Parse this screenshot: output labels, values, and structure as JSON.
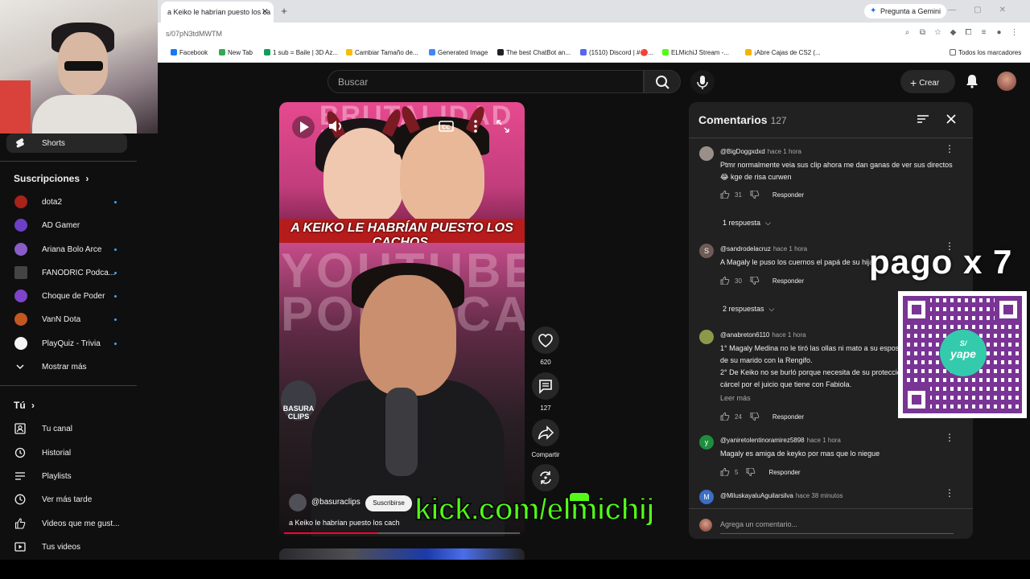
{
  "browser": {
    "tab_title": "a Keiko le habrían puesto los ca",
    "url": "s/07pN3tdMWTM",
    "gemini_label": "Pregunta a Gemini",
    "bookmarks": [
      {
        "label": "Facebook",
        "color": "#1877f2"
      },
      {
        "label": "New Tab",
        "color": "#34a853"
      },
      {
        "label": "1 sub = Baile | 3D Az...",
        "color": "#0f9d58"
      },
      {
        "label": "Cambiar Tamaño de...",
        "color": "#fbbc05"
      },
      {
        "label": "Generated Image",
        "color": "#4285f4"
      },
      {
        "label": "The best ChatBot an...",
        "color": "#202124"
      },
      {
        "label": "(1510) Discord | #🔴...",
        "color": "#5865f2"
      },
      {
        "label": "ELMichiJ Stream -...",
        "color": "#53fc18"
      },
      {
        "label": "¡Abre Cajas de CS2 (...",
        "color": "#f4b400"
      }
    ],
    "all_bookmarks": "Todos los marcadores"
  },
  "topbar": {
    "search_placeholder": "Buscar",
    "create_label": "Crear"
  },
  "sidebar": {
    "shorts_label": "Shorts",
    "subscriptions_title": "Suscripciones",
    "subscriptions": [
      {
        "label": "dota2",
        "color": "#a8231a",
        "dot": true
      },
      {
        "label": "AD Gamer",
        "color": "#6c3fc5",
        "dot": false
      },
      {
        "label": "Ariana Bolo Arce",
        "color": "#8a5cc7",
        "dot": true
      },
      {
        "label": "FANODRIC Podca...",
        "color": "#444444",
        "dot": true
      },
      {
        "label": "Choque de Poder",
        "color": "#7e43c9",
        "dot": true
      },
      {
        "label": "VanN Dota",
        "color": "#c4571f",
        "dot": true
      },
      {
        "label": "PlayQuiz - Trivia",
        "color": "#f5f5f5",
        "dot": true
      }
    ],
    "show_more": "Mostrar más",
    "you_title": "Tú",
    "you_items": [
      "Tu canal",
      "Historial",
      "Playlists",
      "Ver más tarde",
      "Videos que me gust...",
      "Tus videos"
    ]
  },
  "short": {
    "caption": "A KEIKO LE HABRÍAN PUESTO LOS CACHOS.",
    "bg_top_text": "BRUTALIDAD POLÍTICA",
    "bg_bottom_text": "YOUTUBE POLÍTICA",
    "channel_logo_text": "BASURA CLIPS",
    "channel": "@basuraclips",
    "subscribe_label": "Suscribirse",
    "title": "a Keiko le habrían puesto los cach",
    "progress": 0.4,
    "likes": "620",
    "comments_count": "127",
    "share_label": "Compartir"
  },
  "overlays": {
    "kick_text": "kick.com/elmichij",
    "pago_text": "pago x 7",
    "yape_text": "yape",
    "yape_mark": "S/"
  },
  "comments": {
    "title": "Comentarios",
    "count": "127",
    "add_placeholder": "Agrega un comentario...",
    "reply_label": "Responder",
    "read_more": "Leer más",
    "items": [
      {
        "author": "@BigDoggxdxd",
        "time": "hace 1 hora",
        "text": "Ptmr normalmente veia sus clip ahora me dan ganas de ver sus directos 😂 kge de risa curwen",
        "likes": "31",
        "replies": "1 respuesta",
        "avatar_color": "#9a8f8a",
        "avatar_letter": ""
      },
      {
        "author": "@sandrodelacruz",
        "time": "hace 1 hora",
        "text": "A Magaly le puso los cuernos el papá de su hija",
        "likes": "30",
        "replies": "2 respuestas",
        "avatar_color": "#6f5a56",
        "avatar_letter": "S"
      },
      {
        "author": "@anabreton6110",
        "time": "hace 1 hora",
        "text": "1° Magaly Medina no le tiró las ollas ni mato a su esposo por la infidelidad de su marido con la Rengifo.\n2° De Keiko no se burló porque necesita de su protección para no ir a la cárcel por el juicio que tiene con Fabiola.",
        "likes": "24",
        "replies": "",
        "avatar_color": "#8a9a4a",
        "avatar_letter": ""
      },
      {
        "author": "@yaniretolentinoramirez5898",
        "time": "hace 1 hora",
        "text": "Magaly es amiga de keyko por mas que lo niegue",
        "likes": "5",
        "replies": "",
        "avatar_color": "#1e8e3e",
        "avatar_letter": "y"
      },
      {
        "author": "@MiluskayaluAguilarsilva",
        "time": "hace 38 minutos",
        "text": "",
        "likes": "",
        "replies": "",
        "avatar_color": "#3b6ec7",
        "avatar_letter": "M"
      }
    ]
  }
}
